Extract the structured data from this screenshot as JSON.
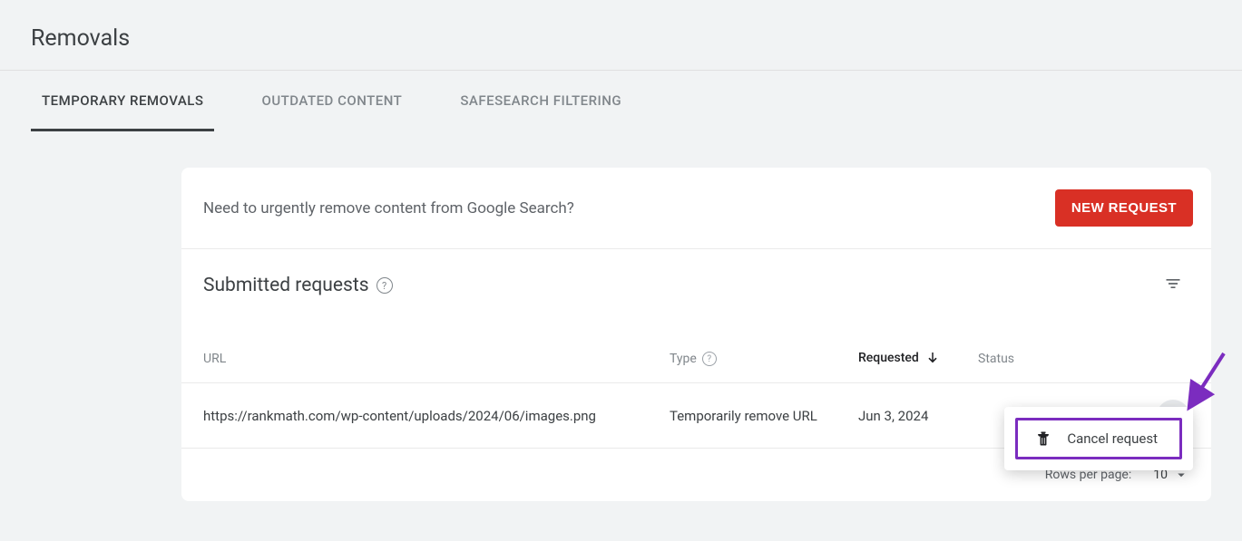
{
  "header": {
    "title": "Removals"
  },
  "tabs": {
    "temporary_removals": "TEMPORARY REMOVALS",
    "outdated_content": "OUTDATED CONTENT",
    "safesearch_filtering": "SAFESEARCH FILTERING"
  },
  "card_header": {
    "prompt": "Need to urgently remove content from Google Search?",
    "new_request_button": "NEW REQUEST"
  },
  "section": {
    "title": "Submitted requests"
  },
  "columns": {
    "url": "URL",
    "type": "Type",
    "requested": "Requested",
    "status": "Status"
  },
  "rows": [
    {
      "url": "https://rankmath.com/wp-content/uploads/2024/06/images.png",
      "type": "Temporarily remove URL",
      "requested": "Jun 3, 2024",
      "status": ""
    }
  ],
  "footer": {
    "rows_per_page_label": "Rows per page:",
    "rows_per_page_value": "10"
  },
  "menu": {
    "cancel_request": "Cancel request"
  }
}
